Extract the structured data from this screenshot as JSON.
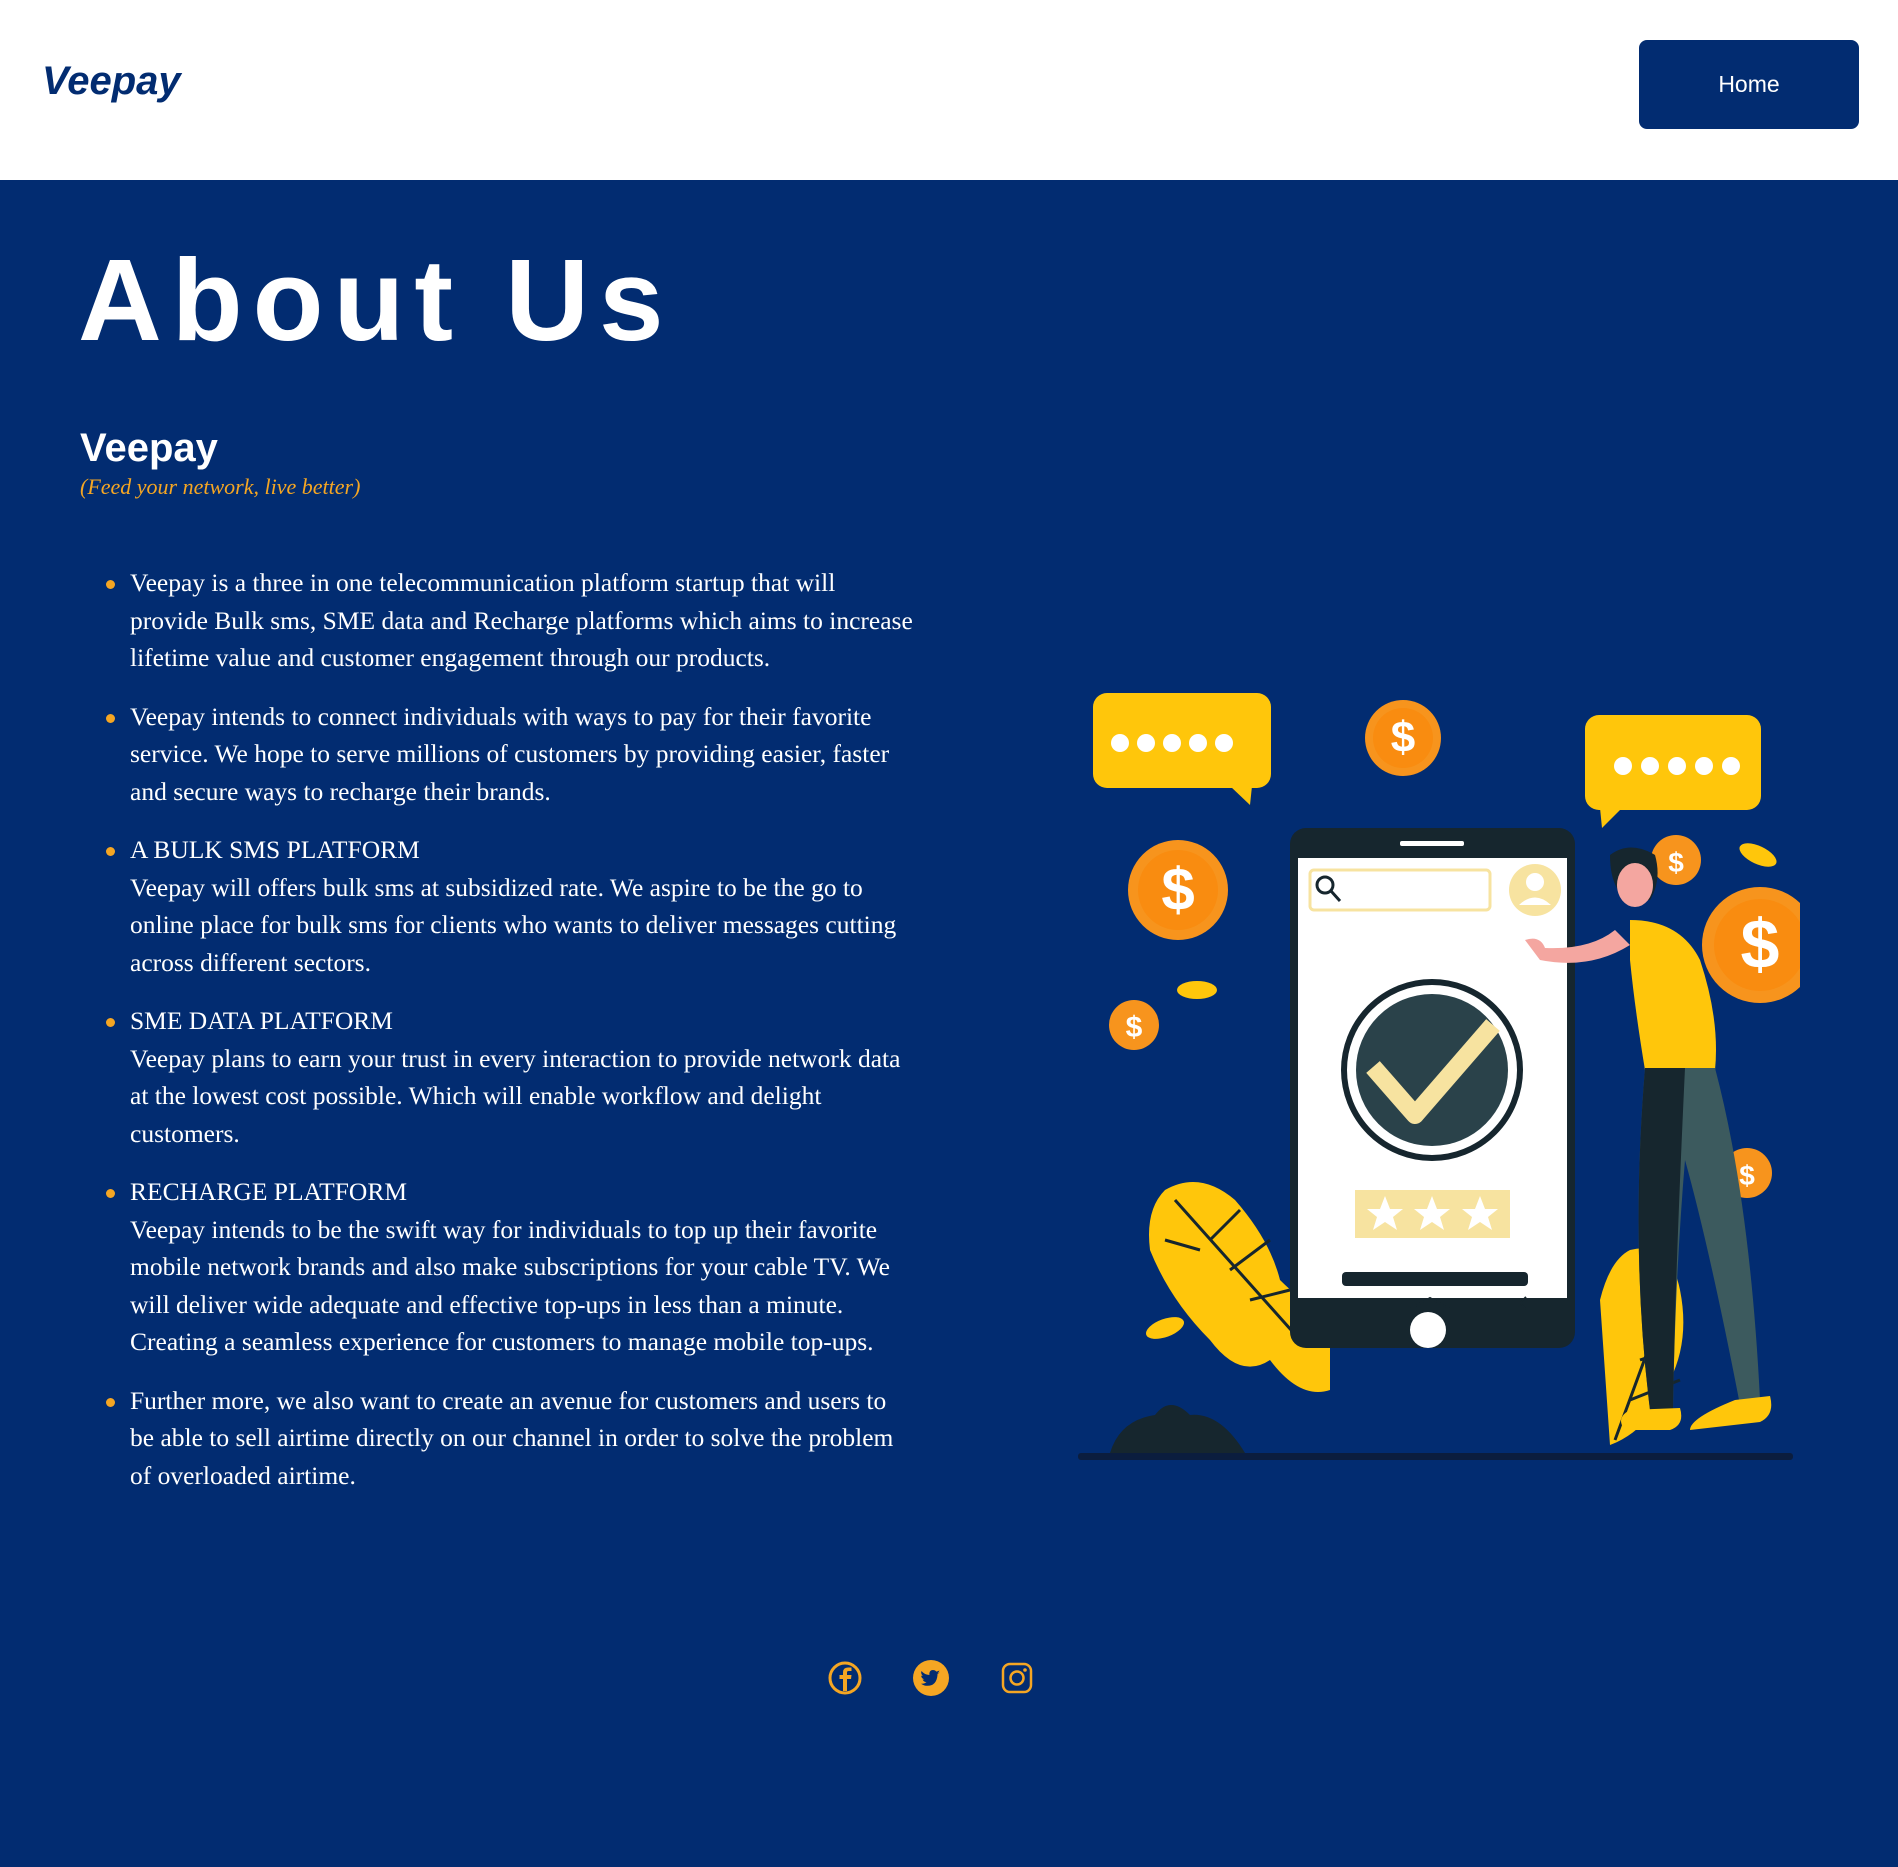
{
  "header": {
    "logo_text": "Veepay",
    "nav": {
      "home_label": "Home"
    }
  },
  "about": {
    "title": "About Us",
    "brand": "Veepay",
    "tagline": "(Feed your network, live better)",
    "items": [
      {
        "heading": "",
        "text": "Veepay is a three in one telecommunication platform startup that will provide Bulk sms, SME data and Recharge platforms which aims to increase lifetime value and customer engagement through our products."
      },
      {
        "heading": "",
        "text": "Veepay intends to connect individuals with ways to pay for their favorite service. We hope to serve millions of customers by providing easier, faster and secure ways to recharge their brands."
      },
      {
        "heading": "A BULK SMS PLATFORM",
        "text": "Veepay will offers bulk sms at subsidized rate. We aspire to be the go to online place for bulk sms for clients who wants to deliver messages cutting across different sectors."
      },
      {
        "heading": "SME DATA PLATFORM",
        "text": "Veepay plans to earn your trust in every interaction to provide network data at the lowest cost possible. Which will enable workflow and delight customers."
      },
      {
        "heading": "RECHARGE PLATFORM",
        "text": "Veepay intends to be the swift way for individuals to top up their favorite mobile network brands and also make subscriptions for your cable TV. We will deliver wide adequate and effective top-ups in less than a minute. Creating a seamless experience for customers to manage mobile top-ups."
      },
      {
        "heading": "",
        "text": "Further more, we also want to create an avenue for customers and users to be able to sell airtime directly on our channel in order to solve the problem of overloaded airtime."
      }
    ]
  },
  "footer": {
    "social_icons": [
      "facebook-icon",
      "twitter-icon",
      "instagram-icon"
    ]
  },
  "colors": {
    "navy": "#022c71",
    "accent": "#f5a623",
    "yellow": "#ffc60b",
    "orange": "#f7941d",
    "white": "#ffffff"
  }
}
